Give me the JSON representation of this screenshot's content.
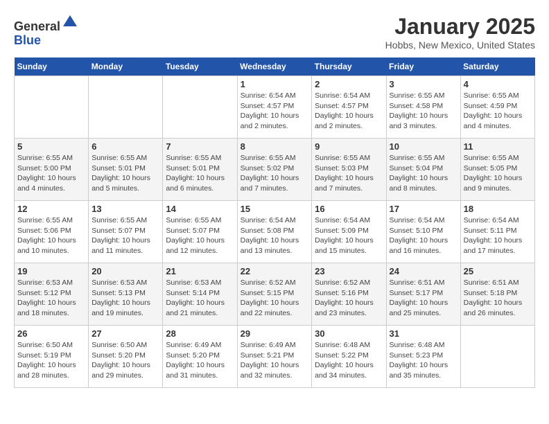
{
  "header": {
    "logo_general": "General",
    "logo_blue": "Blue",
    "month_title": "January 2025",
    "location": "Hobbs, New Mexico, United States"
  },
  "days_of_week": [
    "Sunday",
    "Monday",
    "Tuesday",
    "Wednesday",
    "Thursday",
    "Friday",
    "Saturday"
  ],
  "weeks": [
    [
      {
        "day": "",
        "sunrise": "",
        "sunset": "",
        "daylight": ""
      },
      {
        "day": "",
        "sunrise": "",
        "sunset": "",
        "daylight": ""
      },
      {
        "day": "",
        "sunrise": "",
        "sunset": "",
        "daylight": ""
      },
      {
        "day": "1",
        "sunrise": "Sunrise: 6:54 AM",
        "sunset": "Sunset: 4:57 PM",
        "daylight": "Daylight: 10 hours and 2 minutes."
      },
      {
        "day": "2",
        "sunrise": "Sunrise: 6:54 AM",
        "sunset": "Sunset: 4:57 PM",
        "daylight": "Daylight: 10 hours and 2 minutes."
      },
      {
        "day": "3",
        "sunrise": "Sunrise: 6:55 AM",
        "sunset": "Sunset: 4:58 PM",
        "daylight": "Daylight: 10 hours and 3 minutes."
      },
      {
        "day": "4",
        "sunrise": "Sunrise: 6:55 AM",
        "sunset": "Sunset: 4:59 PM",
        "daylight": "Daylight: 10 hours and 4 minutes."
      }
    ],
    [
      {
        "day": "5",
        "sunrise": "Sunrise: 6:55 AM",
        "sunset": "Sunset: 5:00 PM",
        "daylight": "Daylight: 10 hours and 4 minutes."
      },
      {
        "day": "6",
        "sunrise": "Sunrise: 6:55 AM",
        "sunset": "Sunset: 5:01 PM",
        "daylight": "Daylight: 10 hours and 5 minutes."
      },
      {
        "day": "7",
        "sunrise": "Sunrise: 6:55 AM",
        "sunset": "Sunset: 5:01 PM",
        "daylight": "Daylight: 10 hours and 6 minutes."
      },
      {
        "day": "8",
        "sunrise": "Sunrise: 6:55 AM",
        "sunset": "Sunset: 5:02 PM",
        "daylight": "Daylight: 10 hours and 7 minutes."
      },
      {
        "day": "9",
        "sunrise": "Sunrise: 6:55 AM",
        "sunset": "Sunset: 5:03 PM",
        "daylight": "Daylight: 10 hours and 7 minutes."
      },
      {
        "day": "10",
        "sunrise": "Sunrise: 6:55 AM",
        "sunset": "Sunset: 5:04 PM",
        "daylight": "Daylight: 10 hours and 8 minutes."
      },
      {
        "day": "11",
        "sunrise": "Sunrise: 6:55 AM",
        "sunset": "Sunset: 5:05 PM",
        "daylight": "Daylight: 10 hours and 9 minutes."
      }
    ],
    [
      {
        "day": "12",
        "sunrise": "Sunrise: 6:55 AM",
        "sunset": "Sunset: 5:06 PM",
        "daylight": "Daylight: 10 hours and 10 minutes."
      },
      {
        "day": "13",
        "sunrise": "Sunrise: 6:55 AM",
        "sunset": "Sunset: 5:07 PM",
        "daylight": "Daylight: 10 hours and 11 minutes."
      },
      {
        "day": "14",
        "sunrise": "Sunrise: 6:55 AM",
        "sunset": "Sunset: 5:07 PM",
        "daylight": "Daylight: 10 hours and 12 minutes."
      },
      {
        "day": "15",
        "sunrise": "Sunrise: 6:54 AM",
        "sunset": "Sunset: 5:08 PM",
        "daylight": "Daylight: 10 hours and 13 minutes."
      },
      {
        "day": "16",
        "sunrise": "Sunrise: 6:54 AM",
        "sunset": "Sunset: 5:09 PM",
        "daylight": "Daylight: 10 hours and 15 minutes."
      },
      {
        "day": "17",
        "sunrise": "Sunrise: 6:54 AM",
        "sunset": "Sunset: 5:10 PM",
        "daylight": "Daylight: 10 hours and 16 minutes."
      },
      {
        "day": "18",
        "sunrise": "Sunrise: 6:54 AM",
        "sunset": "Sunset: 5:11 PM",
        "daylight": "Daylight: 10 hours and 17 minutes."
      }
    ],
    [
      {
        "day": "19",
        "sunrise": "Sunrise: 6:53 AM",
        "sunset": "Sunset: 5:12 PM",
        "daylight": "Daylight: 10 hours and 18 minutes."
      },
      {
        "day": "20",
        "sunrise": "Sunrise: 6:53 AM",
        "sunset": "Sunset: 5:13 PM",
        "daylight": "Daylight: 10 hours and 19 minutes."
      },
      {
        "day": "21",
        "sunrise": "Sunrise: 6:53 AM",
        "sunset": "Sunset: 5:14 PM",
        "daylight": "Daylight: 10 hours and 21 minutes."
      },
      {
        "day": "22",
        "sunrise": "Sunrise: 6:52 AM",
        "sunset": "Sunset: 5:15 PM",
        "daylight": "Daylight: 10 hours and 22 minutes."
      },
      {
        "day": "23",
        "sunrise": "Sunrise: 6:52 AM",
        "sunset": "Sunset: 5:16 PM",
        "daylight": "Daylight: 10 hours and 23 minutes."
      },
      {
        "day": "24",
        "sunrise": "Sunrise: 6:51 AM",
        "sunset": "Sunset: 5:17 PM",
        "daylight": "Daylight: 10 hours and 25 minutes."
      },
      {
        "day": "25",
        "sunrise": "Sunrise: 6:51 AM",
        "sunset": "Sunset: 5:18 PM",
        "daylight": "Daylight: 10 hours and 26 minutes."
      }
    ],
    [
      {
        "day": "26",
        "sunrise": "Sunrise: 6:50 AM",
        "sunset": "Sunset: 5:19 PM",
        "daylight": "Daylight: 10 hours and 28 minutes."
      },
      {
        "day": "27",
        "sunrise": "Sunrise: 6:50 AM",
        "sunset": "Sunset: 5:20 PM",
        "daylight": "Daylight: 10 hours and 29 minutes."
      },
      {
        "day": "28",
        "sunrise": "Sunrise: 6:49 AM",
        "sunset": "Sunset: 5:20 PM",
        "daylight": "Daylight: 10 hours and 31 minutes."
      },
      {
        "day": "29",
        "sunrise": "Sunrise: 6:49 AM",
        "sunset": "Sunset: 5:21 PM",
        "daylight": "Daylight: 10 hours and 32 minutes."
      },
      {
        "day": "30",
        "sunrise": "Sunrise: 6:48 AM",
        "sunset": "Sunset: 5:22 PM",
        "daylight": "Daylight: 10 hours and 34 minutes."
      },
      {
        "day": "31",
        "sunrise": "Sunrise: 6:48 AM",
        "sunset": "Sunset: 5:23 PM",
        "daylight": "Daylight: 10 hours and 35 minutes."
      },
      {
        "day": "",
        "sunrise": "",
        "sunset": "",
        "daylight": ""
      }
    ]
  ]
}
